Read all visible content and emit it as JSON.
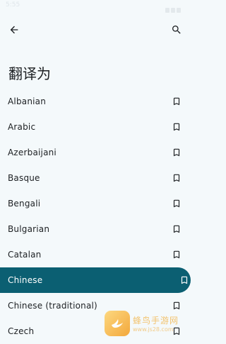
{
  "status_bar": {
    "time": "5:55"
  },
  "top_bar": {
    "back_icon": "arrow-back-icon",
    "search_icon": "search-icon"
  },
  "page": {
    "title": "翻译为"
  },
  "languages": [
    {
      "label": "Albanian",
      "selected": false
    },
    {
      "label": "Arabic",
      "selected": false
    },
    {
      "label": "Azerbaijani",
      "selected": false
    },
    {
      "label": "Basque",
      "selected": false
    },
    {
      "label": "Bengali",
      "selected": false
    },
    {
      "label": "Bulgarian",
      "selected": false
    },
    {
      "label": "Catalan",
      "selected": false
    },
    {
      "label": "Chinese",
      "selected": true
    },
    {
      "label": "Chinese (traditional)",
      "selected": false
    },
    {
      "label": "Czech",
      "selected": false
    }
  ],
  "colors": {
    "background": "#f4f9fb",
    "selected_row": "#0b5f72",
    "selected_text": "#ffffff",
    "text": "#1c1f22"
  },
  "watermark": {
    "name": "蜂鸟手游网",
    "url": "www.js28.com"
  }
}
